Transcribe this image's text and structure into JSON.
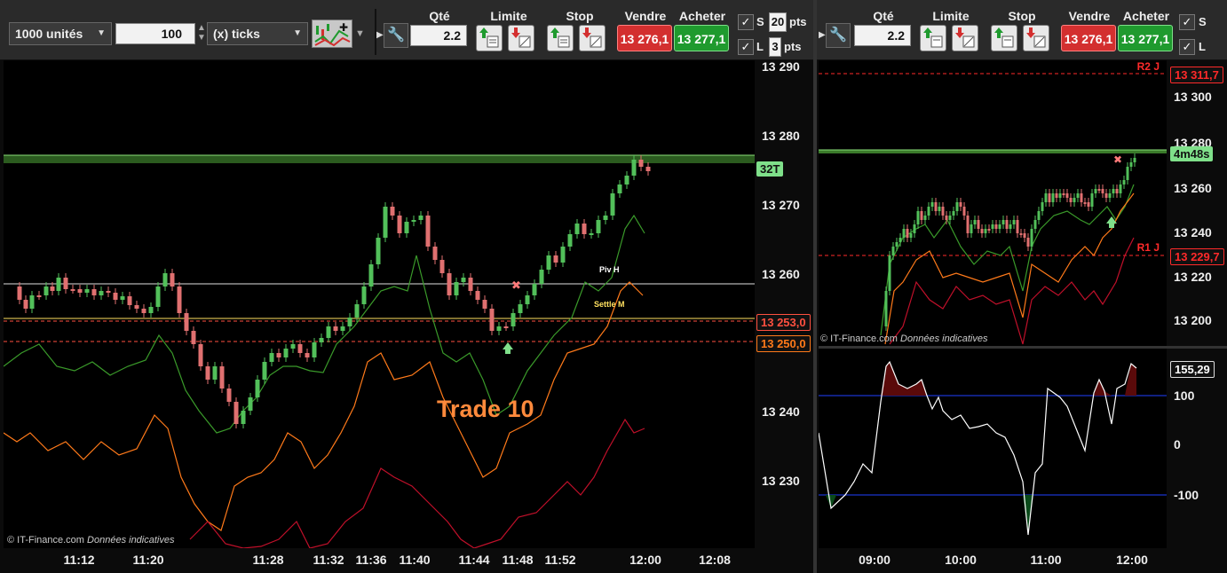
{
  "left_toolbar": {
    "units_value": "1000 unités",
    "quantity_value": "100",
    "ticks_label": "(x) ticks",
    "qty_header": "Qté",
    "qty_value": "2.2",
    "limit_header": "Limite",
    "stop_header": "Stop",
    "sell_header": "Vendre",
    "buy_header": "Acheter",
    "sell_price": "13 276,1",
    "buy_price": "13 277,1",
    "s_label": "S",
    "s_value": "20",
    "s_unit": "pts",
    "l_label": "L",
    "l_value": "3",
    "l_unit": "pts"
  },
  "right_toolbar": {
    "qty_header": "Qté",
    "qty_value": "2.2",
    "limit_header": "Limite",
    "stop_header": "Stop",
    "sell_header": "Vendre",
    "buy_header": "Acheter",
    "sell_price": "13 276,1",
    "buy_price": "13 277,1",
    "s_label": "S",
    "l_label": "L"
  },
  "left_chart": {
    "watermark": "© IT-Finance.com",
    "watermark_note": "Données indicatives",
    "trade_label": "Trade 10",
    "piv_label": "Piv H",
    "settle_label": "Settle M",
    "countdown_tag": "32T",
    "price_tag_1": "13 253,0",
    "price_tag_2": "13 250,0",
    "y_labels": [
      "13 290",
      "13 280",
      "13 270",
      "13 260",
      "13 240",
      "13 230"
    ],
    "x_labels": [
      "11:12",
      "11:20",
      "11:28",
      "11:32",
      "11:36",
      "11:40",
      "11:44",
      "11:48",
      "11:52",
      "12:00",
      "12:08"
    ]
  },
  "right_chart": {
    "watermark": "© IT-Finance.com",
    "watermark_note": "Données indicatives",
    "r2_label": "R2 J",
    "r1_label": "R1 J",
    "r2_tag": "13 311,7",
    "r1_tag": "13 229,7",
    "countdown_tag": "4m48s",
    "y_labels": [
      "13 300",
      "13 280",
      "13 260",
      "13 240",
      "13 220",
      "13 200"
    ],
    "osc_value_tag": "155,29",
    "osc_labels": [
      "100",
      "0",
      "-100"
    ],
    "x_labels": [
      "09:00",
      "10:00",
      "11:00",
      "12:00"
    ]
  },
  "colors": {
    "bull": "#52c05a",
    "bear": "#e07070",
    "ma_green": "#3a9a2a",
    "ma_orange": "#ff7a1a",
    "ma_red": "#c0102a",
    "trade_text": "#ff8a3c",
    "resistance_red": "#ff2a2a"
  }
}
